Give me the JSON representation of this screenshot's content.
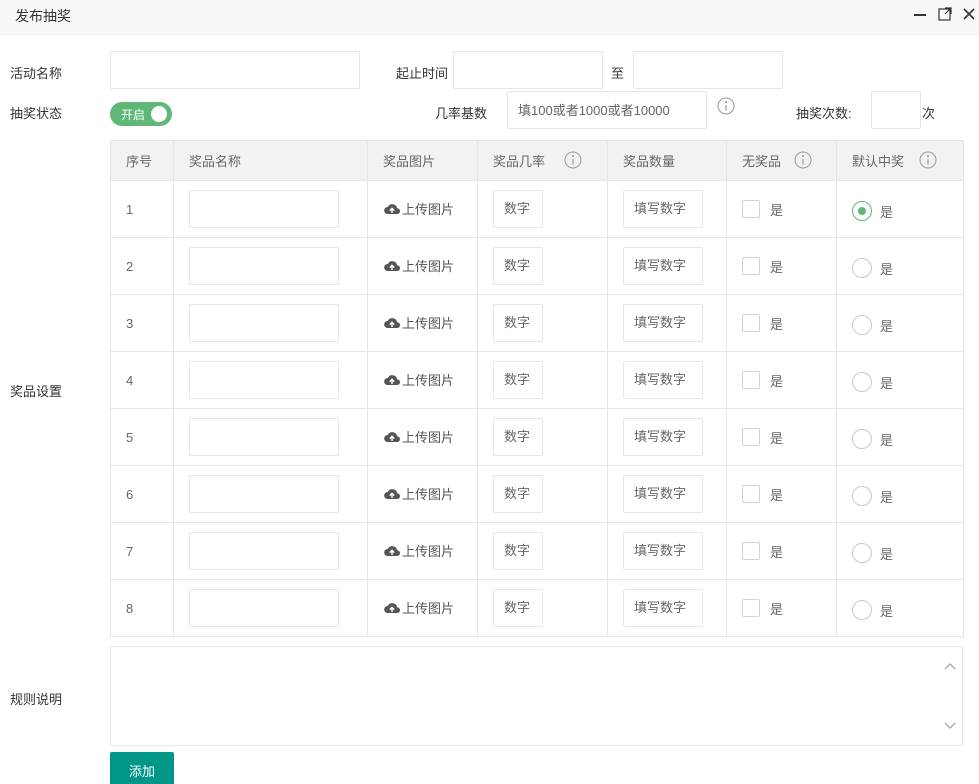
{
  "window": {
    "title": "发布抽奖"
  },
  "form": {
    "activity_name_label": "活动名称",
    "activity_name_value": "",
    "time_range_label": "起止时间",
    "time_start_value": "",
    "time_to_label": "至",
    "time_end_value": "",
    "status_label": "抽奖状态",
    "status_switch_text": "开启",
    "status_on": true,
    "odds_base_label": "几率基数",
    "odds_base_placeholder": "填100或者1000或者10000",
    "draw_count_label": "抽奖次数:",
    "draw_count_value": "",
    "draw_count_unit": "次",
    "prize_settings_label": "奖品设置",
    "rules_label": "规则说明",
    "rules_value": "",
    "add_button": "添加"
  },
  "table": {
    "headers": [
      "序号",
      "奖品名称",
      "奖品图片",
      "奖品几率",
      "奖品数量",
      "无奖品",
      "默认中奖"
    ],
    "upload_label": "上传图片",
    "rate_placeholder": "数字",
    "qty_placeholder": "填写数字",
    "checkbox_label": "是",
    "radio_label": "是",
    "rows": [
      {
        "index": "1",
        "name": "",
        "no_prize": false,
        "default_win": true
      },
      {
        "index": "2",
        "name": "",
        "no_prize": false,
        "default_win": false
      },
      {
        "index": "3",
        "name": "",
        "no_prize": false,
        "default_win": false
      },
      {
        "index": "4",
        "name": "",
        "no_prize": false,
        "default_win": false
      },
      {
        "index": "5",
        "name": "",
        "no_prize": false,
        "default_win": false
      },
      {
        "index": "6",
        "name": "",
        "no_prize": false,
        "default_win": false
      },
      {
        "index": "7",
        "name": "",
        "no_prize": false,
        "default_win": false
      },
      {
        "index": "8",
        "name": "",
        "no_prize": false,
        "default_win": false
      }
    ]
  },
  "icons": {
    "minimize": "minimize-icon",
    "maximize": "maximize-icon",
    "close": "close-icon",
    "info": "info-icon",
    "upload": "cloud-upload-icon"
  },
  "colors": {
    "accent_green": "#5FB878",
    "button_teal": "#009688"
  }
}
